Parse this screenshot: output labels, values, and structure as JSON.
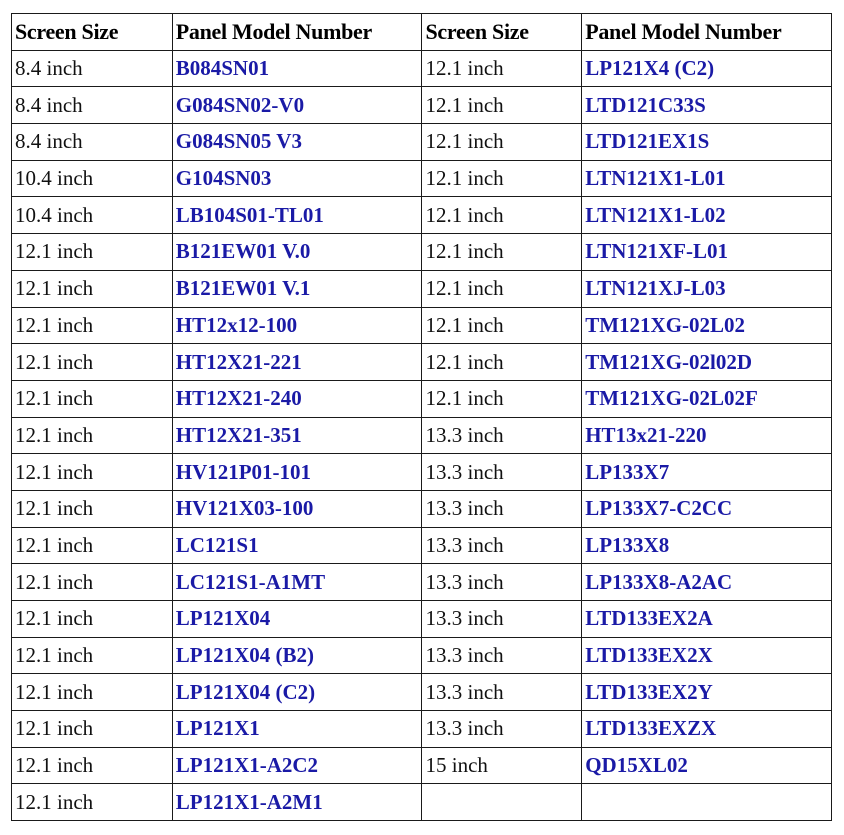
{
  "table": {
    "headers": [
      "Screen Size",
      "Panel Model Number",
      "Screen Size",
      "Panel Model Number"
    ],
    "colors": {
      "model_text": "#1a1aa6",
      "size_text": "#111111",
      "border": "#1a1a1a"
    },
    "rows": [
      {
        "size1": "8.4 inch",
        "model1": "B084SN01",
        "size2": "12.1 inch",
        "model2": "LP121X4 (C2)"
      },
      {
        "size1": "8.4 inch",
        "model1": "G084SN02-V0",
        "size2": "12.1 inch",
        "model2": "LTD121C33S"
      },
      {
        "size1": "8.4 inch",
        "model1": "G084SN05 V3",
        "size2": "12.1 inch",
        "model2": "LTD121EX1S"
      },
      {
        "size1": "10.4 inch",
        "model1": "G104SN03",
        "size2": "12.1 inch",
        "model2": "LTN121X1-L01"
      },
      {
        "size1": "10.4 inch",
        "model1": "LB104S01-TL01",
        "size2": "12.1 inch",
        "model2": "LTN121X1-L02"
      },
      {
        "size1": "12.1 inch",
        "model1": "B121EW01 V.0",
        "size2": "12.1 inch",
        "model2": "LTN121XF-L01"
      },
      {
        "size1": "12.1 inch",
        "model1": "B121EW01 V.1",
        "size2": "12.1 inch",
        "model2": "LTN121XJ-L03"
      },
      {
        "size1": "12.1 inch",
        "model1": "HT12x12-100",
        "size2": "12.1 inch",
        "model2": "TM121XG-02L02"
      },
      {
        "size1": "12.1 inch",
        "model1": "HT12X21-221",
        "size2": "12.1 inch",
        "model2": "TM121XG-02l02D"
      },
      {
        "size1": "12.1 inch",
        "model1": "HT12X21-240",
        "size2": "12.1 inch",
        "model2": "TM121XG-02L02F"
      },
      {
        "size1": "12.1 inch",
        "model1": "HT12X21-351",
        "size2": "13.3 inch",
        "model2": "HT13x21-220"
      },
      {
        "size1": "12.1 inch",
        "model1": "HV121P01-101",
        "size2": "13.3 inch",
        "model2": "LP133X7"
      },
      {
        "size1": "12.1 inch",
        "model1": "HV121X03-100",
        "size2": "13.3 inch",
        "model2": "LP133X7-C2CC"
      },
      {
        "size1": "12.1 inch",
        "model1": "LC121S1",
        "size2": "13.3 inch",
        "model2": "LP133X8"
      },
      {
        "size1": "12.1 inch",
        "model1": "LC121S1-A1MT",
        "size2": "13.3 inch",
        "model2": "LP133X8-A2AC"
      },
      {
        "size1": "12.1 inch",
        "model1": "LP121X04",
        "size2": "13.3 inch",
        "model2": "LTD133EX2A"
      },
      {
        "size1": "12.1 inch",
        "model1": "LP121X04 (B2)",
        "size2": "13.3 inch",
        "model2": "LTD133EX2X"
      },
      {
        "size1": "12.1 inch",
        "model1": "LP121X04 (C2)",
        "size2": "13.3 inch",
        "model2": "LTD133EX2Y"
      },
      {
        "size1": "12.1 inch",
        "model1": "LP121X1",
        "size2": "13.3 inch",
        "model2": "LTD133EXZX"
      },
      {
        "size1": "12.1 inch",
        "model1": "LP121X1-A2C2",
        "size2": "15 inch",
        "model2": "QD15XL02"
      },
      {
        "size1": "12.1 inch",
        "model1": "LP121X1-A2M1",
        "size2": "",
        "model2": ""
      }
    ]
  }
}
